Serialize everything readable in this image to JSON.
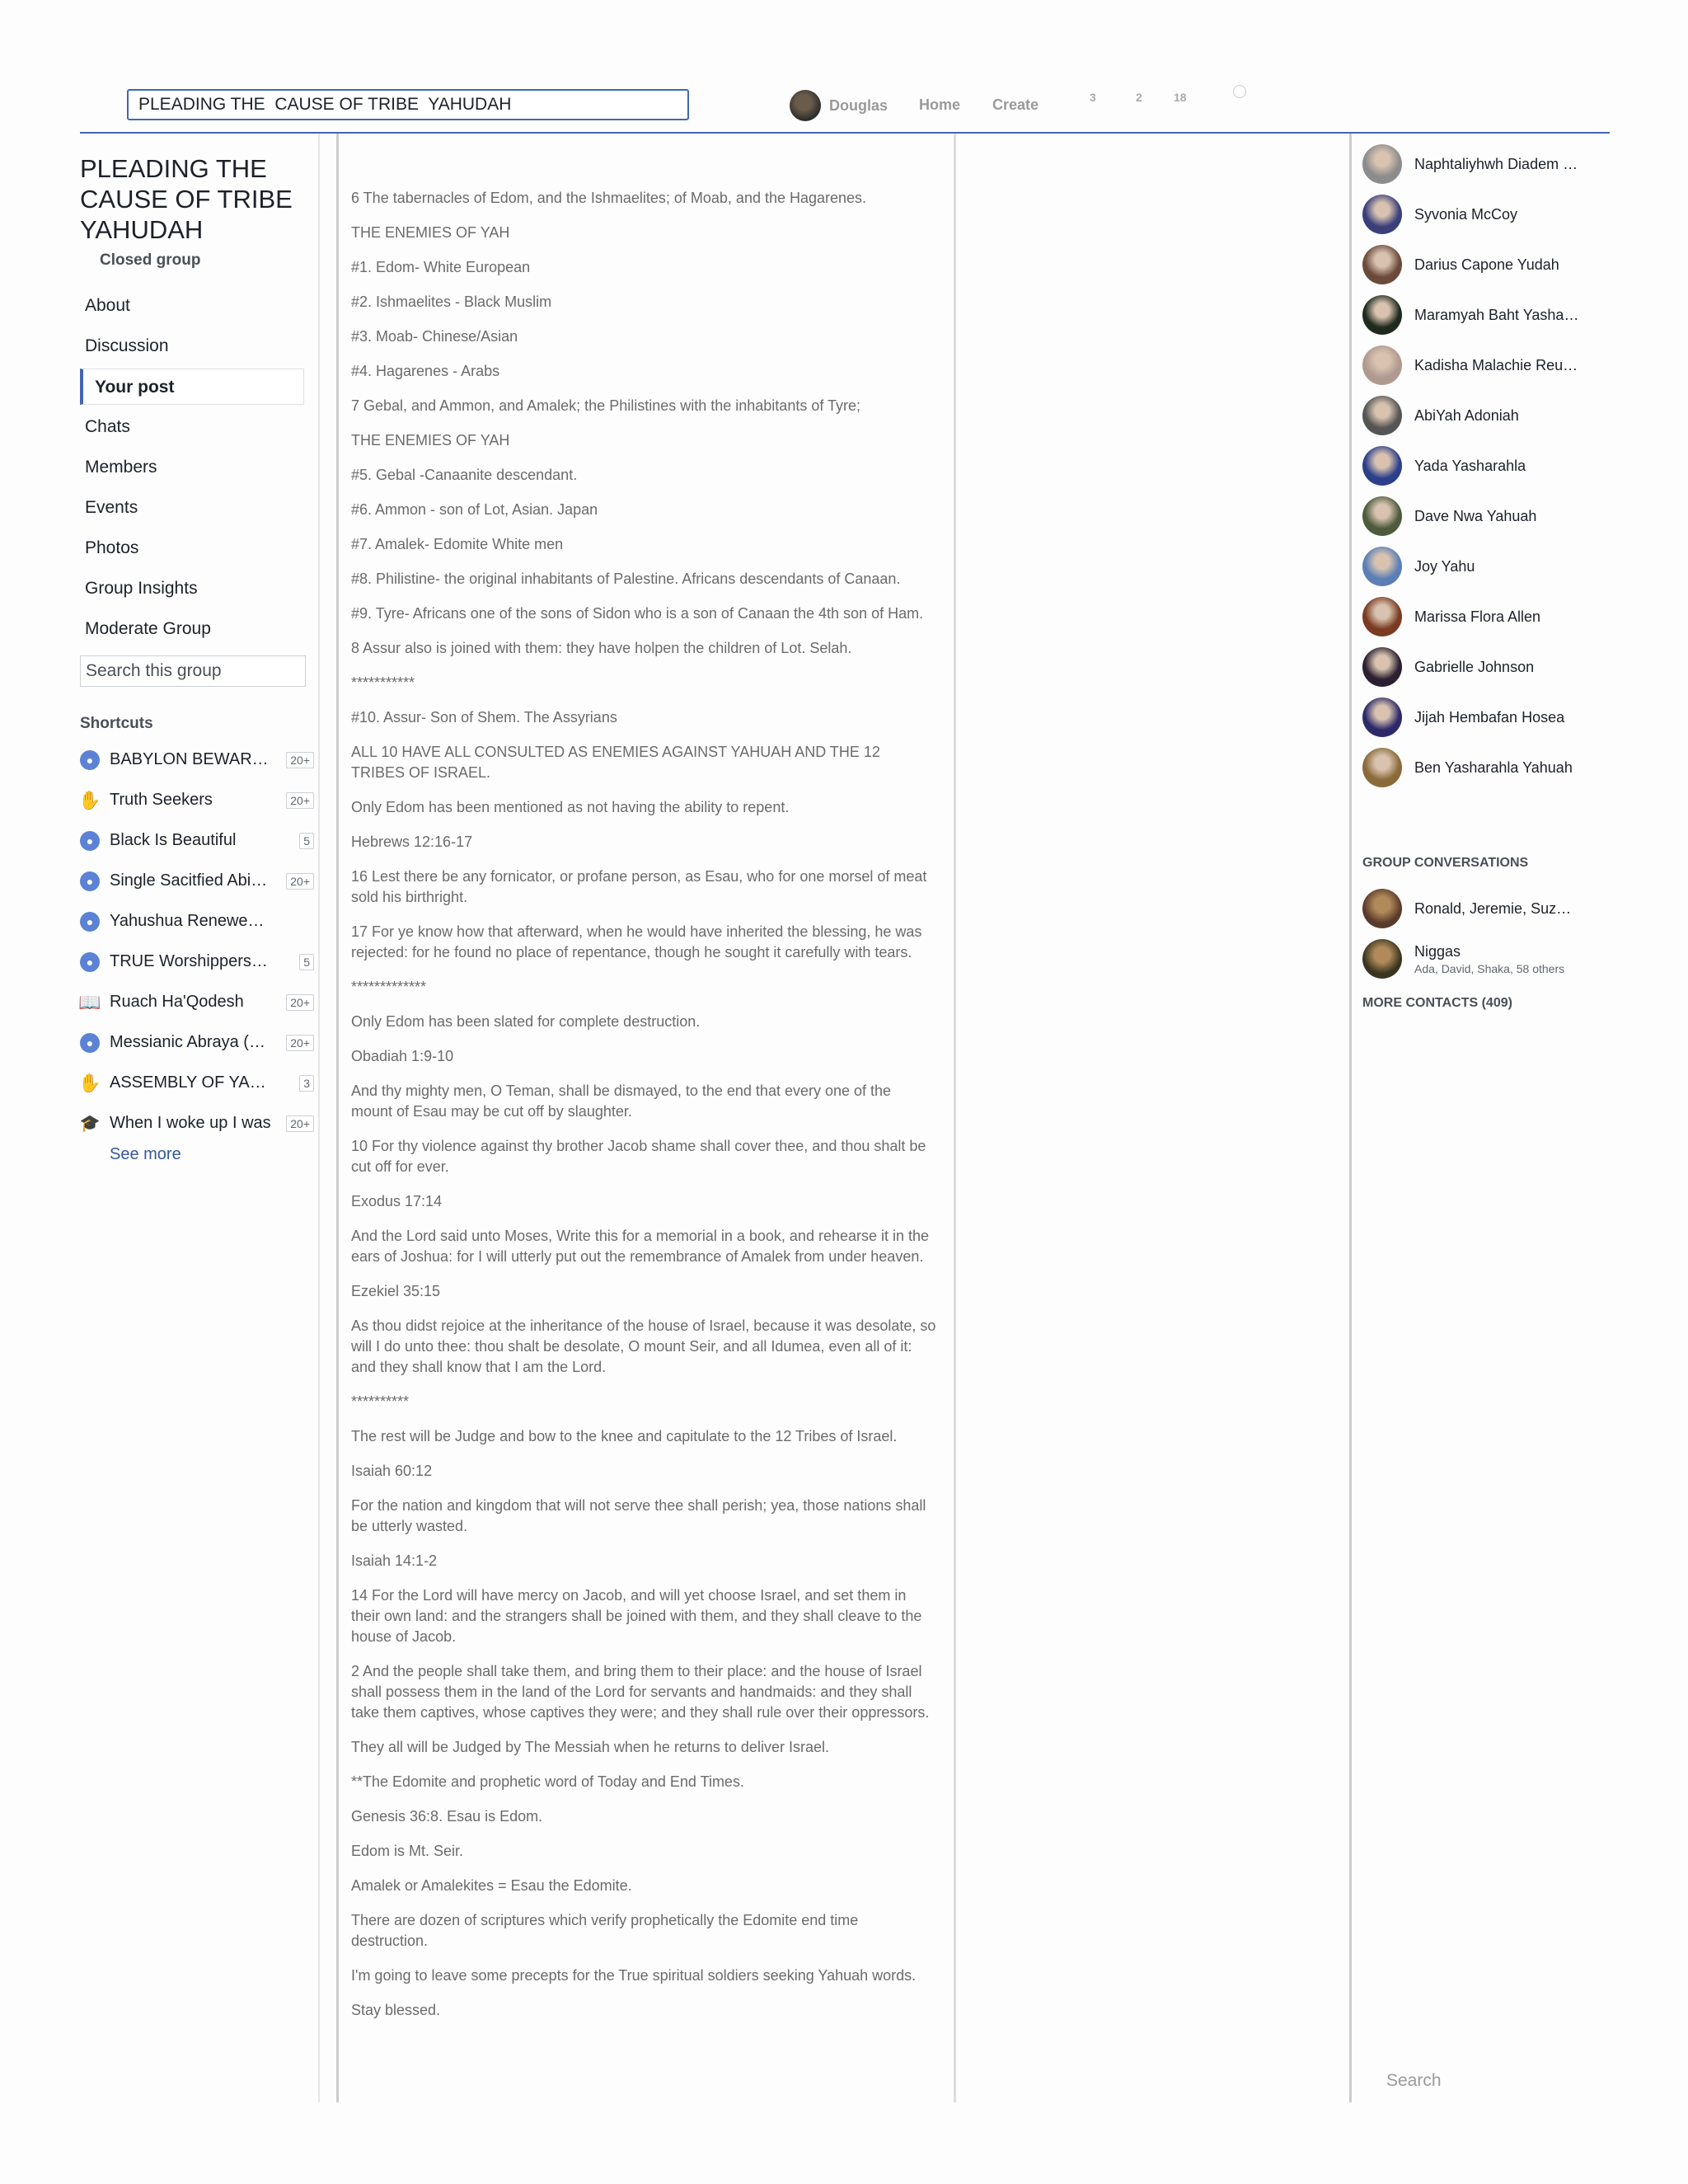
{
  "topbar": {
    "search_value": "PLEADING THE  CAUSE OF TRIBE  YAHUDAH",
    "user_name": "Douglas",
    "home_label": "Home",
    "create_label": "Create",
    "friend_requests_count": "3",
    "messages_count": "2",
    "notifications_count": "18"
  },
  "group": {
    "title": "PLEADING THE CAUSE OF TRIBE YAHUDAH",
    "privacy": "Closed group"
  },
  "menu": [
    {
      "label": "About"
    },
    {
      "label": "Discussion"
    },
    {
      "label": "Your post"
    },
    {
      "label": "Chats"
    },
    {
      "label": "Members"
    },
    {
      "label": "Events"
    },
    {
      "label": "Photos"
    },
    {
      "label": "Group Insights"
    },
    {
      "label": "Moderate Group"
    }
  ],
  "group_search_placeholder": "Search this group",
  "shortcuts": {
    "heading": "Shortcuts",
    "items": [
      {
        "label": "BABYLON BEWARE THE WRATH",
        "badge": "20+",
        "icon": "group-icon"
      },
      {
        "label": "Truth Seekers",
        "badge": "20+",
        "icon": "hand-icon"
      },
      {
        "label": "Black Is Beautiful",
        "badge": "5",
        "icon": "group-icon"
      },
      {
        "label": "Single Sacitfied Abiding",
        "badge": "20+",
        "icon": "group-icon"
      },
      {
        "label": "Yahushua Renewed Covenant",
        "badge": "",
        "icon": "group-icon"
      },
      {
        "label": "TRUE Worshippers in Spirit",
        "badge": "5",
        "icon": "group-icon"
      },
      {
        "label": "Ruach Ha'Qodesh",
        "badge": "20+",
        "icon": "book-icon"
      },
      {
        "label": "Messianic Abraya (Hebrews)",
        "badge": "20+",
        "icon": "group-icon"
      },
      {
        "label": "ASSEMBLY OF YAHUAH",
        "badge": "3",
        "icon": "hand-icon"
      },
      {
        "label": "When I woke up I was",
        "badge": "20+",
        "icon": "cap-icon"
      }
    ],
    "see_more": "See more"
  },
  "post": {
    "lines": [
      "6 The tabernacles of Edom, and the Ishmaelites; of Moab, and the Hagarenes.",
      "THE ENEMIES OF YAH",
      "#1. Edom- White European",
      "#2. Ishmaelites - Black Muslim",
      "#3. Moab- Chinese/Asian",
      "#4. Hagarenes - Arabs",
      "7 Gebal, and Ammon, and Amalek; the Philistines with the inhabitants of Tyre;",
      "THE ENEMIES OF YAH",
      "#5. Gebal -Canaanite descendant.",
      "#6. Ammon - son of Lot, Asian. Japan",
      "#7. Amalek- Edomite White men",
      "#8. Philistine- the original inhabitants of Palestine. Africans descendants of Canaan.",
      "#9. Tyre- Africans one of the sons of Sidon who is a son of Canaan the 4th son of Ham.",
      "8 Assur also is joined with them: they have holpen the children of Lot. Selah.",
      "***********",
      "#10. Assur- Son of Shem. The Assyrians",
      "ALL 10 HAVE ALL CONSULTED AS ENEMIES AGAINST YAHUAH AND THE 12 TRIBES OF ISRAEL.",
      "Only Edom has been mentioned as not having the ability to repent.",
      "Hebrews 12:16-17",
      "16 Lest there be any fornicator, or profane person, as Esau, who for one morsel of meat sold his birthright.",
      "17 For ye know how that afterward, when he would have inherited the blessing, he was rejected: for he found no place of repentance, though he sought it carefully with tears.",
      "*************",
      "Only Edom has been slated for complete destruction.",
      "Obadiah 1:9-10",
      "And thy mighty men, O Teman, shall be dismayed, to the end that every one of the mount of Esau may be cut off by slaughter.",
      "10 For thy violence against thy brother Jacob shame shall cover thee, and thou shalt be cut off for ever.",
      "Exodus 17:14",
      "And the Lord said unto Moses, Write this for a memorial in a book, and rehearse it in the ears of Joshua: for I will utterly put out the remembrance of Amalek from under heaven.",
      "Ezekiel 35:15",
      "As thou didst rejoice at the inheritance of the house of Israel, because it was desolate, so will I do unto thee: thou shalt be desolate, O mount Seir, and all Idumea, even all of it: and they shall know that I am the Lord.",
      "**********",
      "The rest will be Judge and bow to the knee and capitulate to the 12 Tribes of Israel.",
      "Isaiah 60:12",
      "For the nation and kingdom that will not serve thee shall perish; yea, those nations shall be utterly wasted.",
      "Isaiah 14:1-2",
      "14 For the Lord will have mercy on Jacob, and will yet choose Israel, and set them in their own land: and the strangers shall be joined with them, and they shall cleave to the house of Jacob.",
      "2 And the people shall take them, and bring them to their place: and the house of Israel shall possess them in the land of the Lord for servants and handmaids: and they shall take them captives, whose captives they were; and they shall rule over their oppressors.",
      "They all will be Judged by The Messiah when he returns to deliver Israel.",
      "**The Edomite and prophetic word of Today and End Times.",
      "Genesis 36:8. Esau is Edom.",
      "Edom is Mt. Seir.",
      "Amalek or Amalekites = Esau the Edomite.",
      "There are dozen of scriptures which verify prophetically the Edomite end time destruction.",
      "I'm going to leave some precepts for the True spiritual soldiers seeking Yahuah words.",
      "Stay blessed."
    ]
  },
  "contacts": [
    {
      "name": "Naphtaliyhwh Diadem Israel",
      "color": "#8c8c8c"
    },
    {
      "name": "Syvonia McCoy",
      "color": "#3a3f7a"
    },
    {
      "name": "Darius Capone Yudah",
      "color": "#6b4a3a"
    },
    {
      "name": "Maramyah Baht Yashar'el",
      "color": "#1f2a1f"
    },
    {
      "name": "Kadisha Malachie Reuben",
      "color": "#b09a90"
    },
    {
      "name": "AbiYah Adoniah",
      "color": "#555555"
    },
    {
      "name": "Yada Yasharahla",
      "color": "#2b3f8a"
    },
    {
      "name": "Dave Nwa Yahuah",
      "color": "#4d5a3c"
    },
    {
      "name": "Joy Yahu",
      "color": "#5b7fb5"
    },
    {
      "name": "Marissa Flora Allen",
      "color": "#7a3b22"
    },
    {
      "name": "Gabrielle Johnson",
      "color": "#2a2030"
    },
    {
      "name": "Jijah Hembafan Hosea",
      "color": "#2e2a6a"
    },
    {
      "name": "Ben Yasharahla Yahuah",
      "color": "#8a6a3a"
    }
  ],
  "group_conversations": {
    "heading": "GROUP CONVERSATIONS",
    "items": [
      {
        "name": "Ronald, Jeremie, Suzanne",
        "sub": "",
        "color": "#5a3a2a"
      },
      {
        "name": "Niggas",
        "sub": "Ada, David, Shaka, 58 others",
        "color": "#3a3520"
      }
    ],
    "more_contacts": "MORE CONTACTS (409)"
  },
  "chat_search_placeholder": "Search",
  "colors": {
    "accent": "#4267b2",
    "link": "#365899",
    "post_text": "#6b6b6b"
  }
}
